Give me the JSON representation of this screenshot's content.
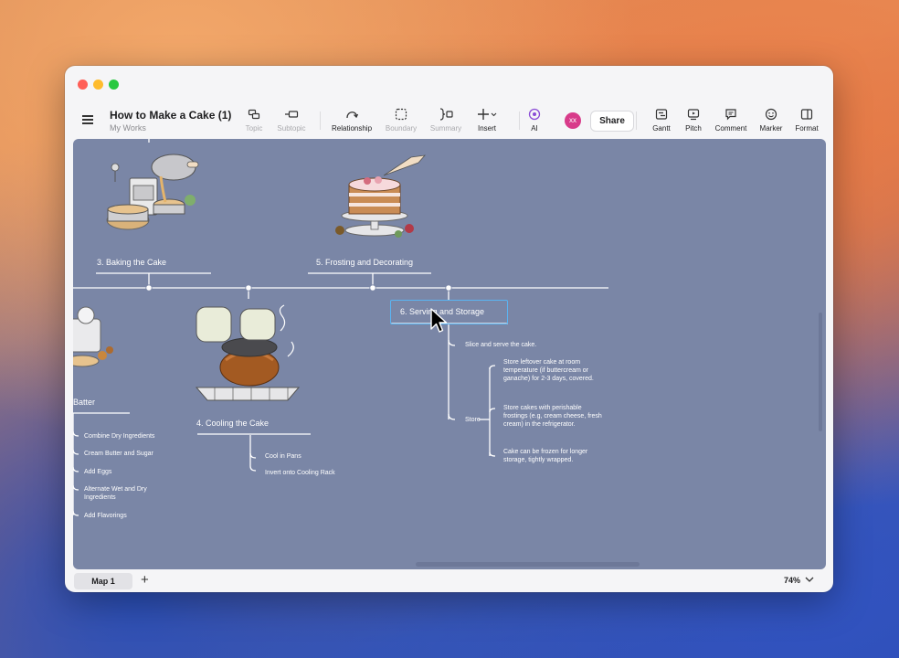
{
  "document": {
    "title": "How to Make a Cake (1)",
    "subtitle": "My Works"
  },
  "toolbar": {
    "topic": "Topic",
    "subtopic": "Subtopic",
    "relationship": "Relationship",
    "boundary": "Boundary",
    "summary": "Summary",
    "insert": "Insert",
    "ai": "AI",
    "avatar": "xx",
    "share": "Share",
    "gantt": "Gantt",
    "pitch": "Pitch",
    "comment": "Comment",
    "marker": "Marker",
    "format": "Format"
  },
  "colors": {
    "canvas": "#7a86a6",
    "selection": "#5ab4f2",
    "line": "#ffffff"
  },
  "map": {
    "topics": {
      "baking": "3. Baking the Cake",
      "frosting": "5. Frosting and Decorating",
      "batter": "Batter",
      "cooling": "4. Cooling the Cake",
      "serving": "6. Serving and Storage"
    },
    "batter_steps": [
      "Combine Dry Ingredients",
      "Cream Butter and Sugar",
      "Add Eggs",
      "Alternate Wet and Dry Ingredients",
      "Add Flavorings"
    ],
    "cooling_steps": [
      "Cool in Pans",
      "Invert onto Cooling Rack"
    ],
    "serving": {
      "slice": "Slice and serve the cake.",
      "store": "Store",
      "store_notes": [
        "Store leftover cake at room temperature (if buttercream or ganache) for 2-3 days, covered.",
        "Store cakes with perishable frostings (e.g, cream cheese, fresh cream) in the refrigerator.",
        "Cake can be frozen for longer storage, tightly wrapped."
      ]
    }
  },
  "statusbar": {
    "tab": "Map 1",
    "zoom": "74%"
  }
}
